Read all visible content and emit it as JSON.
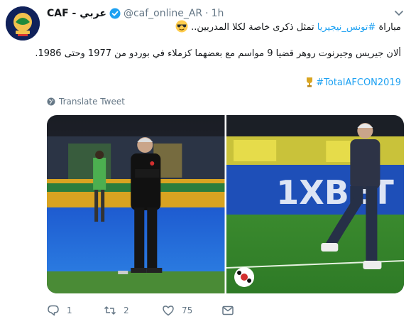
{
  "tweet": {
    "account_name": "CAF - عربي",
    "handle": "@caf_online_AR",
    "separator": "·",
    "time": "1h",
    "line1": "مباراة",
    "line1_hashtag": "#تونس_نيجيريا",
    "line1_rest": "تمثل ذكرى خاصة لكلا المدربين..",
    "line2": "ألان جيريس وجيرنوت روهر قضيا 9 مواسم مع بعضهما كزملاء في بوردو من 1977 وحتى 1986.",
    "hashtag3": "#TotalAFCON2019",
    "translate_label": "Translate Tweet",
    "reply_count": "1",
    "retweet_count": "2",
    "like_count": "75"
  },
  "icons": {
    "verified": "verified-badge-icon",
    "chevron": "chevron-down-icon",
    "emoji": "sunglasses-emoji-icon",
    "trophy": "trophy-icon",
    "globe": "globe-icon",
    "reply": "reply-icon",
    "retweet": "retweet-icon",
    "like": "heart-icon",
    "message": "envelope-icon"
  },
  "colors": {
    "link": "#1da1f2",
    "muted": "#657786",
    "text": "#14171a",
    "verified": "#1da1f2"
  }
}
